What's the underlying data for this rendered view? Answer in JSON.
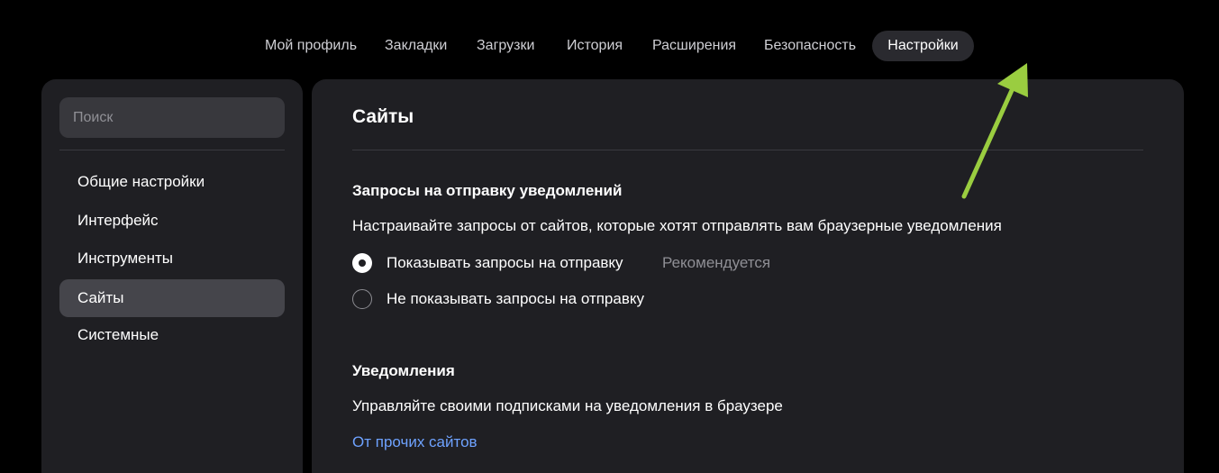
{
  "topnav": {
    "tabs": [
      {
        "label": "Мой профиль"
      },
      {
        "label": "Закладки"
      },
      {
        "label": "Загрузки"
      },
      {
        "label": "История"
      },
      {
        "label": "Расширения"
      },
      {
        "label": "Безопасность"
      },
      {
        "label": "Настройки",
        "active": true
      }
    ]
  },
  "sidebar": {
    "search_placeholder": "Поиск",
    "items": [
      {
        "label": "Общие настройки"
      },
      {
        "label": "Интерфейс"
      },
      {
        "label": "Инструменты"
      },
      {
        "label": "Сайты",
        "active": true
      },
      {
        "label": "Системные"
      }
    ]
  },
  "main": {
    "title": "Сайты",
    "notification_requests": {
      "title": "Запросы на отправку уведомлений",
      "description": "Настраивайте запросы от сайтов, которые хотят отправлять вам браузерные уведомления",
      "options": [
        {
          "label": "Показывать запросы на отправку",
          "hint": "Рекомендуется",
          "checked": true
        },
        {
          "label": "Не показывать запросы на отправку",
          "checked": false
        }
      ]
    },
    "notifications": {
      "title": "Уведомления",
      "description": "Управляйте своими подписками на уведомления в браузере",
      "link": "От прочих сайтов"
    }
  },
  "colors": {
    "background": "#000000",
    "panel": "#1f1f23",
    "active_item": "#45454b",
    "link": "#6ea2ff",
    "annotation_arrow": "#9acd40"
  }
}
